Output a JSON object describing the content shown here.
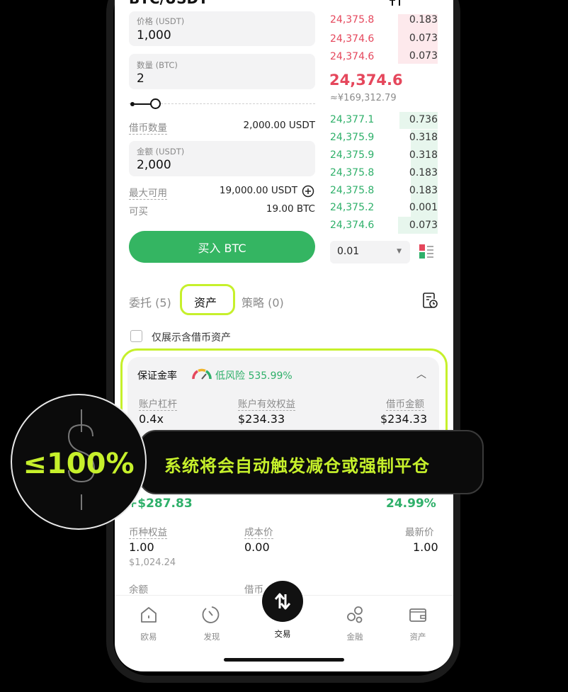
{
  "header": {
    "pair": "BTC/USDT"
  },
  "form": {
    "price_label": "价格 (USDT)",
    "price_value": "1,000",
    "qty_label": "数量 (BTC)",
    "qty_value": "2",
    "borrow_label": "借币数量",
    "borrow_value": "2,000.00 USDT",
    "amount_label": "金额 (USDT)",
    "amount_value": "2,000",
    "max_label": "最大可用",
    "max_value": "19,000.00 USDT",
    "canbuy_label": "可买",
    "canbuy_value": "19.00 BTC",
    "buy_label": "买入 BTC"
  },
  "orderbook": {
    "asks": [
      {
        "price": "24,375.8",
        "qty": "0.183"
      },
      {
        "price": "24,374.6",
        "qty": "0.073"
      },
      {
        "price": "24,374.6",
        "qty": "0.073"
      }
    ],
    "last_price": "24,374.6",
    "last_price_cny": "≈¥169,312.79",
    "bids": [
      {
        "price": "24,377.1",
        "qty": "0.736"
      },
      {
        "price": "24,375.9",
        "qty": "0.318"
      },
      {
        "price": "24,375.9",
        "qty": "0.318"
      },
      {
        "price": "24,375.8",
        "qty": "0.183"
      },
      {
        "price": "24,375.8",
        "qty": "0.183"
      },
      {
        "price": "24,375.2",
        "qty": "0.001"
      },
      {
        "price": "24,374.6",
        "qty": "0.073"
      }
    ],
    "depth_value": "0.01"
  },
  "tabs": {
    "orders": "委托 (5)",
    "assets": "资产",
    "strategy": "策略 (0)"
  },
  "filter_label": "仅展示含借币资产",
  "margin": {
    "title": "保证金率",
    "risk_text": "低风险 535.99%",
    "leverage_label": "账户杠杆",
    "leverage_value": "0.4x",
    "equity_label": "账户有效权益",
    "equity_value": "$234.33",
    "borrow_label": "借币金额",
    "borrow_value": "$234.33"
  },
  "position": {
    "pnl_value": "+$287.83",
    "pnl_pct": "24.99%",
    "coin_equity_label": "币种权益",
    "coin_equity_value": "1.00",
    "coin_equity_usd": "$1,024.24",
    "cost_label": "成本价",
    "cost_value": "0.00",
    "latest_label": "最新价",
    "latest_value": "1.00",
    "balance_label": "余额",
    "borrowed_label": "借币"
  },
  "nav": {
    "home": "欧易",
    "discover": "发现",
    "trade": "交易",
    "finance": "金融",
    "assets": "资产"
  },
  "overlay": {
    "threshold": "≤100%",
    "message": "系统将会自动触发减仓或强制平仓"
  },
  "colors": {
    "accent": "#c6f02b",
    "buy_green": "#34b562",
    "ask_red": "#e5475c",
    "bid_green": "#2fb06a"
  }
}
